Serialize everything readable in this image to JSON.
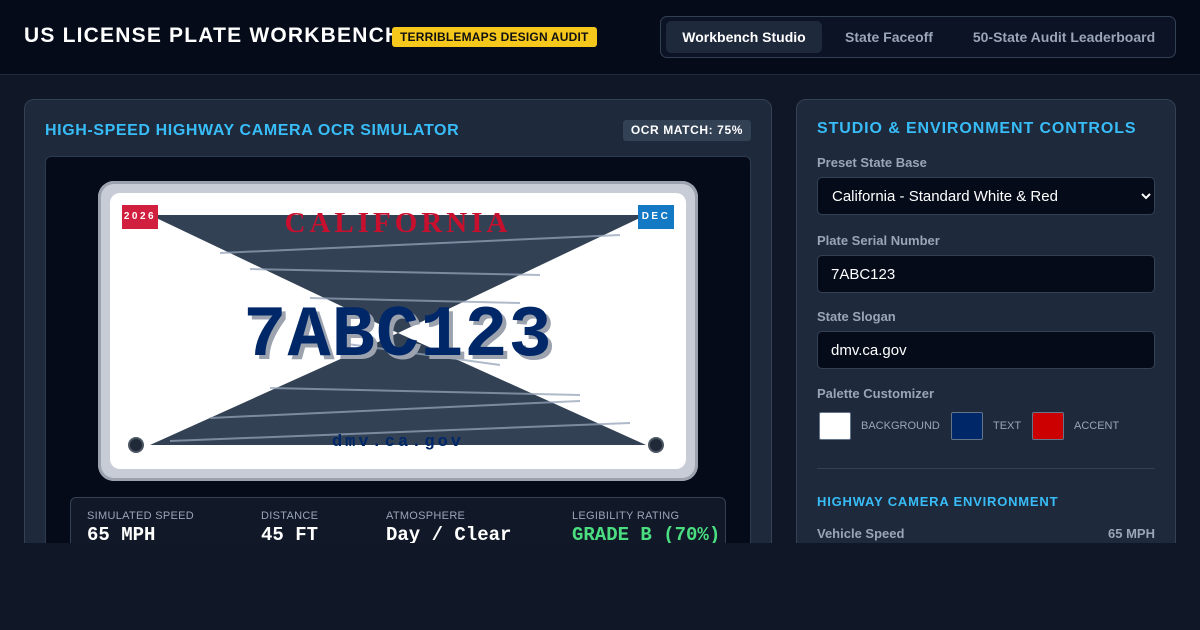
{
  "header": {
    "title": "US LICENSE PLATE WORKBENCH",
    "badge": "TERRIBLEMAPS DESIGN AUDIT",
    "tabs": [
      {
        "label": "Workbench Studio",
        "active": true
      },
      {
        "label": "State Faceoff",
        "active": false
      },
      {
        "label": "50-State Audit Leaderboard",
        "active": false
      }
    ]
  },
  "simulator": {
    "heading": "HIGH-SPEED HIGHWAY CAMERA OCR SIMULATOR",
    "ocr_badge": "OCR MATCH: 75%",
    "plate": {
      "state_name": "CALIFORNIA",
      "serial": "7ABC123",
      "slogan": "dmv.ca.gov",
      "year_sticker": "2026",
      "month_sticker": "DEC"
    },
    "stats": [
      {
        "label": "SIMULATED SPEED",
        "value": "65 MPH"
      },
      {
        "label": "DISTANCE",
        "value": "45 FT"
      },
      {
        "label": "ATMOSPHERE",
        "value": "Day / Clear"
      },
      {
        "label": "LEGIBILITY RATING",
        "value": "GRADE B (70%)"
      }
    ]
  },
  "controls": {
    "heading": "STUDIO & ENVIRONMENT CONTROLS",
    "preset_label": "Preset State Base",
    "preset_value": "California - Standard White & Red",
    "serial_label": "Plate Serial Number",
    "serial_value": "7ABC123",
    "slogan_label": "State Slogan",
    "slogan_value": "dmv.ca.gov",
    "palette_label": "Palette Customizer",
    "palette": [
      {
        "label": "BACKGROUND",
        "color": "#ffffff"
      },
      {
        "label": "TEXT",
        "color": "#002868"
      },
      {
        "label": "ACCENT",
        "color": "#cc0000"
      }
    ],
    "environment_heading": "HIGHWAY CAMERA ENVIRONMENT",
    "speed_label": "Vehicle Speed",
    "speed_value": "65 MPH"
  },
  "colors": {
    "accent_heading": "#38bdf8",
    "badge": "#f7c81c",
    "plate_state": "#c8102e",
    "plate_text": "#002868",
    "grade_good": "#4ade80"
  }
}
